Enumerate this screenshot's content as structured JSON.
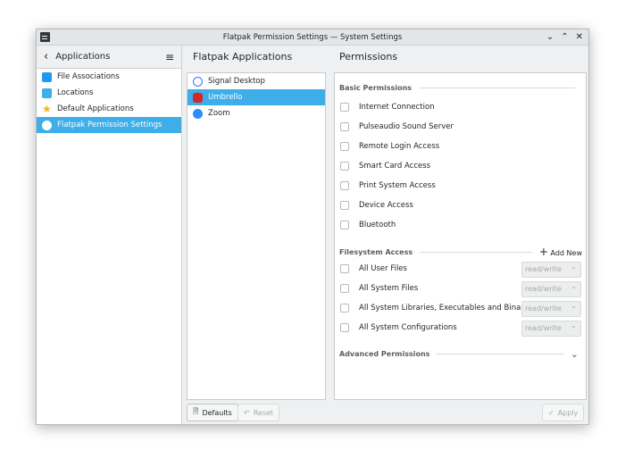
{
  "window": {
    "title": "Flatpak Permission Settings — System Settings",
    "controls": [
      "⌄",
      "⌃",
      "✕"
    ]
  },
  "sidebar": {
    "title": "Applications",
    "items": [
      {
        "label": "File Associations",
        "color": "#1d99f3"
      },
      {
        "label": "Locations",
        "color": "#3daee9"
      },
      {
        "label": "Default Applications",
        "color": "#f6b223"
      },
      {
        "label": "Flatpak Permission Settings",
        "color": "#ffffff"
      }
    ]
  },
  "apps": {
    "title": "Flatpak Applications",
    "items": [
      {
        "label": "Signal Desktop",
        "color": "#3a76f0"
      },
      {
        "label": "Umbrello",
        "color": "#d62828"
      },
      {
        "label": "Zoom",
        "color": "#2d8cff"
      }
    ]
  },
  "permissions": {
    "title": "Permissions",
    "basic_title": "Basic Permissions",
    "basic": [
      "Internet Connection",
      "Pulseaudio Sound Server",
      "Remote Login Access",
      "Smart Card Access",
      "Print System Access",
      "Device Access",
      "Bluetooth"
    ],
    "fs_title": "Filesystem Access",
    "add_new": "Add New",
    "fs": [
      {
        "label": "All User Files",
        "mode": "read/write"
      },
      {
        "label": "All System Files",
        "mode": "read/write"
      },
      {
        "label": "All System Libraries, Executables and Binaries",
        "mode": "read/write"
      },
      {
        "label": "All System Configurations",
        "mode": "read/write"
      }
    ],
    "advanced_title": "Advanced Permissions"
  },
  "footer": {
    "defaults": "Defaults",
    "reset": "Reset",
    "apply": "Apply"
  }
}
